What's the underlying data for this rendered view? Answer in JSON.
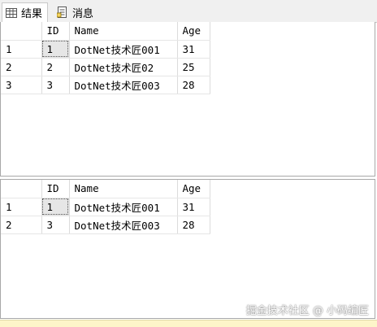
{
  "tabs": [
    {
      "label": "结果",
      "icon": "grid-icon"
    },
    {
      "label": "消息",
      "icon": "message-icon"
    }
  ],
  "result1": {
    "columns": [
      "ID",
      "Name",
      "Age"
    ],
    "rows": [
      {
        "rn": "1",
        "id": "1",
        "name": "DotNet技术匠001",
        "age": "31"
      },
      {
        "rn": "2",
        "id": "2",
        "name": "DotNet技术匠02",
        "age": "25"
      },
      {
        "rn": "3",
        "id": "3",
        "name": "DotNet技术匠003",
        "age": "28"
      }
    ]
  },
  "result2": {
    "columns": [
      "ID",
      "Name",
      "Age"
    ],
    "rows": [
      {
        "rn": "1",
        "id": "1",
        "name": "DotNet技术匠001",
        "age": "31"
      },
      {
        "rn": "2",
        "id": "3",
        "name": "DotNet技术匠003",
        "age": "28"
      }
    ]
  },
  "watermark": "掘金技术社区 @ 小码编匠"
}
